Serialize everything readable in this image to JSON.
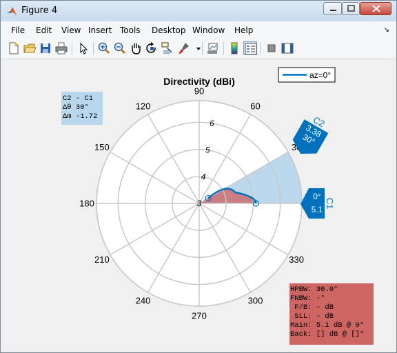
{
  "window": {
    "title": "Figure 4"
  },
  "menu": [
    "File",
    "Edit",
    "View",
    "Insert",
    "Tools",
    "Desktop",
    "Window",
    "Help"
  ],
  "toolbar_icons": [
    "new-figure-icon",
    "open-file-icon",
    "save-icon",
    "print-icon",
    "pointer-icon",
    "zoom-in-icon",
    "zoom-out-icon",
    "pan-icon",
    "rotate-icon",
    "data-cursor-icon",
    "brush-icon",
    "link-plot-icon",
    "colorbar-icon",
    "legend-icon",
    "hide-plot-tools-icon",
    "show-plot-tools-icon"
  ],
  "chart_data": {
    "type": "polar",
    "title": "Directivity (dBi)",
    "legend": {
      "label": "az=0°",
      "position": "top-right"
    },
    "angle_ticks": [
      "0",
      "30",
      "60",
      "90",
      "120",
      "150",
      "180",
      "210",
      "240",
      "270",
      "300",
      "330"
    ],
    "radial_ticks": [
      "3",
      "4",
      "5",
      "6"
    ],
    "rlim": [
      3,
      6.8
    ],
    "series": [
      {
        "name": "az=0°",
        "theta": [
          0,
          30
        ],
        "r": [
          5.1,
          3.38
        ]
      }
    ],
    "markers": [
      {
        "name": "C1",
        "angle": "0°",
        "value": "5.1"
      },
      {
        "name": "C2",
        "angle": "30°",
        "value": "3.38"
      }
    ],
    "span": "30°",
    "delta_box": [
      "C2 - C1",
      "Δθ 30°",
      "Δm -1.72"
    ],
    "metrics": [
      "HPBW: 30.0°",
      "FNBW: -°",
      " F/B: - dB",
      " SLL: - dB",
      "Main: 5.1 dB @ 0°",
      "Back: [] dB @ []°"
    ],
    "colors": {
      "line": "#0072bd",
      "lobe_fill": "#c97476",
      "span_fill": "#b8d6ec",
      "metrics_bg": "#cd6563",
      "marker_bg": "#0072bd"
    }
  }
}
